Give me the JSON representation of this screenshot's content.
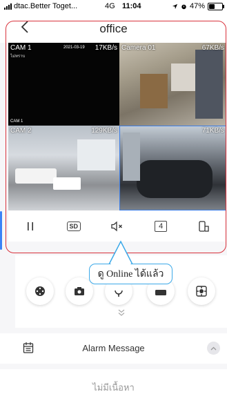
{
  "status_bar": {
    "carrier": "dtac.Better Toget...",
    "network": "4G",
    "time": "11:04",
    "battery": "47%",
    "battery_level": 0.47
  },
  "header": {
    "title": "office"
  },
  "cameras": [
    {
      "label": "CAM 1",
      "sub": "ไม่ทราบ",
      "stamp": "2021-03-19",
      "rate": "17KB/s",
      "bottom": "CAM 1"
    },
    {
      "label": "Camera 01",
      "rate": "67KB/s"
    },
    {
      "label": "CAM 2",
      "rate": "129KB/s"
    },
    {
      "label": "",
      "rate": "71KB/s"
    }
  ],
  "controls": {
    "quality": "SD",
    "split": "4"
  },
  "tooltip": "ดู Online ได้แล้ว",
  "alarm": {
    "label": "Alarm Message",
    "empty_text": "ไม่มีเนื้อหา"
  },
  "colors": {
    "highlight": "#d9323c",
    "tooltip_border": "#3aa8e8",
    "active_cell": "#3c7de6"
  }
}
